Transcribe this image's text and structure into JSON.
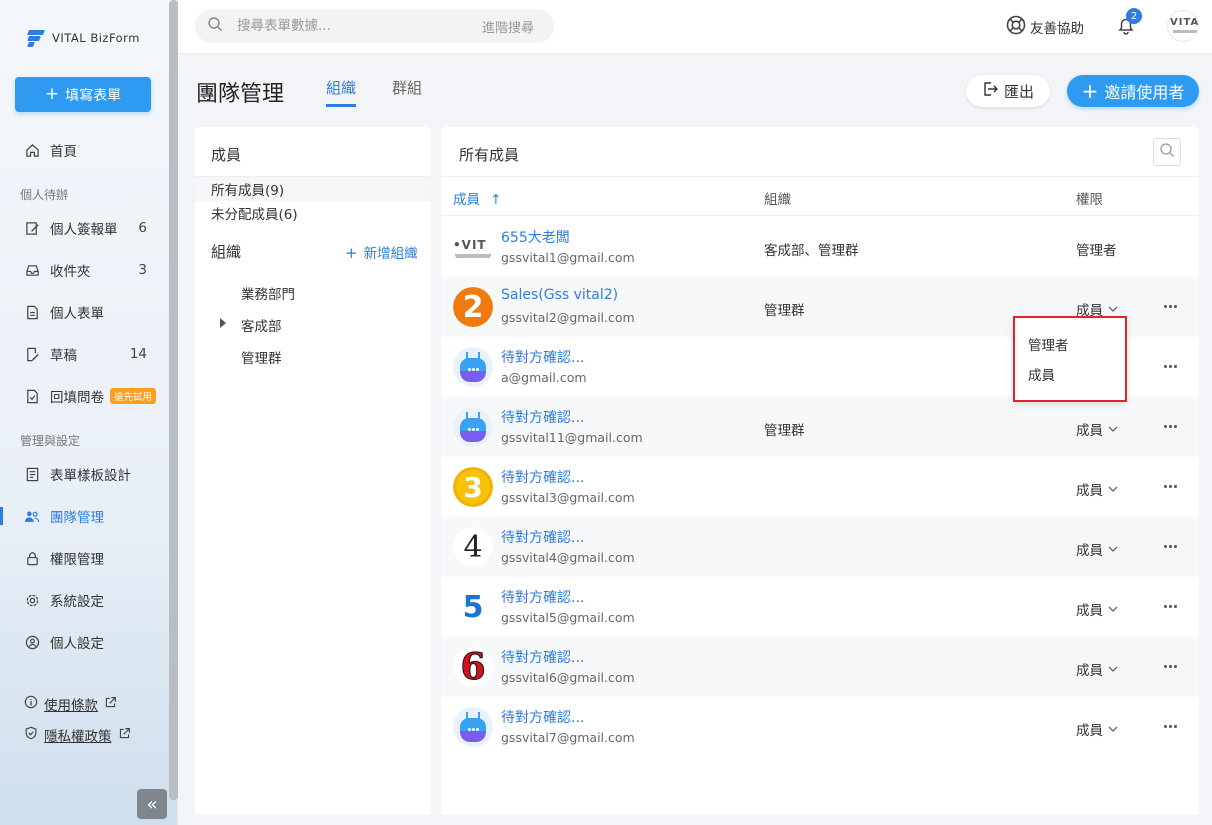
{
  "app": {
    "brand": "VITAL BizForm"
  },
  "sidebar": {
    "fill_form_label": "填寫表單",
    "home_label": "首頁",
    "personal_section": "個人待辦",
    "personal_items": [
      {
        "label": "個人簽報單",
        "count": "6"
      },
      {
        "label": "收件夾",
        "count": "3"
      },
      {
        "label": "個人表單",
        "count": ""
      },
      {
        "label": "草稿",
        "count": "14"
      },
      {
        "label": "回填問卷",
        "badge": "搶先試用"
      }
    ],
    "admin_section": "管理與設定",
    "admin_items": [
      {
        "label": "表單樣板設計"
      },
      {
        "label": "團隊管理"
      },
      {
        "label": "權限管理"
      },
      {
        "label": "系統設定"
      },
      {
        "label": "個人設定"
      }
    ],
    "terms_label": "使用條款",
    "privacy_label": "隱私權政策"
  },
  "topbar": {
    "search_placeholder": "搜尋表單數據...",
    "advanced_search": "進階搜尋",
    "help_label": "友善協助",
    "notification_count": "2",
    "avatar_text": "VITAL"
  },
  "page": {
    "title": "團隊管理",
    "tabs": [
      "組織",
      "群組"
    ],
    "export_label": "匯出",
    "invite_label": "邀請使用者"
  },
  "left_panel": {
    "title": "成員",
    "all_members": "所有成員(9)",
    "unassigned": "未分配成員(6)",
    "org_title": "組織",
    "add_org": "新增組織",
    "tree": [
      "業務部門",
      "客成部",
      "管理群"
    ]
  },
  "right_panel": {
    "title": "所有成員",
    "columns": [
      "成員",
      "組織",
      "權限"
    ],
    "rows": [
      {
        "avatar": "vital-logo",
        "name": "655大老闆",
        "email": "gssvital1@gmail.com",
        "org": "客成部、管理群",
        "perm": "管理者",
        "editable": false
      },
      {
        "avatar": "num-2",
        "name": "Sales(Gss vital2)",
        "email": "gssvital2@gmail.com",
        "org": "管理群",
        "perm": "成員",
        "editable": true
      },
      {
        "avatar": "robot",
        "name": "待對方確認...",
        "email": "a@gmail.com",
        "org": "",
        "perm": "",
        "editable": true
      },
      {
        "avatar": "robot",
        "name": "待對方確認...",
        "email": "gssvital11@gmail.com",
        "org": "管理群",
        "perm": "成員",
        "editable": true
      },
      {
        "avatar": "num-3",
        "name": "待對方確認...",
        "email": "gssvital3@gmail.com",
        "org": "",
        "perm": "成員",
        "editable": true
      },
      {
        "avatar": "num-4",
        "name": "待對方確認...",
        "email": "gssvital4@gmail.com",
        "org": "",
        "perm": "成員",
        "editable": true
      },
      {
        "avatar": "num-5",
        "name": "待對方確認...",
        "email": "gssvital5@gmail.com",
        "org": "",
        "perm": "成員",
        "editable": true
      },
      {
        "avatar": "num-6",
        "name": "待對方確認...",
        "email": "gssvital6@gmail.com",
        "org": "",
        "perm": "成員",
        "editable": true
      },
      {
        "avatar": "robot",
        "name": "待對方確認...",
        "email": "gssvital7@gmail.com",
        "org": "",
        "perm": "成員",
        "editable": true
      }
    ]
  },
  "permission_dropdown": {
    "options": [
      "管理者",
      "成員"
    ]
  },
  "colors": {
    "accent": "#2f7de1",
    "primary_button": "#2f9bf0",
    "trial_badge": "#ff9d1c",
    "highlight_border": "#e0242c"
  }
}
